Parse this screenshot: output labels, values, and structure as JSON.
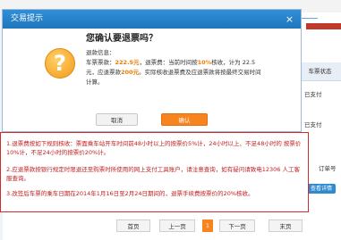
{
  "dialog": {
    "title": "交易提示",
    "close_symbol": "×",
    "heading": "您确认要退票吗？",
    "info_label": "退款信息：",
    "info_line1_a": "车票票款：",
    "ticket_price": "222.5元",
    "info_line1_b": "，退票费：当前时间按",
    "fee_rate": "10%",
    "info_line1_c": "核收，计为 22.5",
    "info_line2_a": "元，应退票款",
    "refund_amount": "200元",
    "info_line2_b": "。实际核收退票费及应退票款将按最终交易时间",
    "info_line3": "计算。",
    "cancel_label": "取消",
    "ok_label": "确认"
  },
  "notes": [
    "1.退票费按如下规则核收：票面乘车站开车时间前48小时以上的按票价5%计，24小时以上、不足48小时的 按票价10%计，不足24小时的按票价20%计。",
    "2.应退票款按银行规定时限退还至购票时所使用的网上支付工具账户，请注意查询，如有疑问请致电12306 人工客服查询。",
    "3.改签后车票的乘车日期在2014年1月16日至2月24日期间的，退票手续费按票价的20%核收。"
  ],
  "pagination": {
    "first": "首页",
    "prev": "上一页",
    "current": "1",
    "next": "下一页",
    "last": "末页"
  },
  "background": {
    "col_header": "车票状态",
    "status_1": "已支付",
    "status_2": "已支付",
    "order_label": "订单号",
    "detail_button": "查看详情"
  },
  "colors": {
    "titlebar": "#1f76bd",
    "accent": "#f7841e",
    "notes_red": "#d12b2b"
  }
}
